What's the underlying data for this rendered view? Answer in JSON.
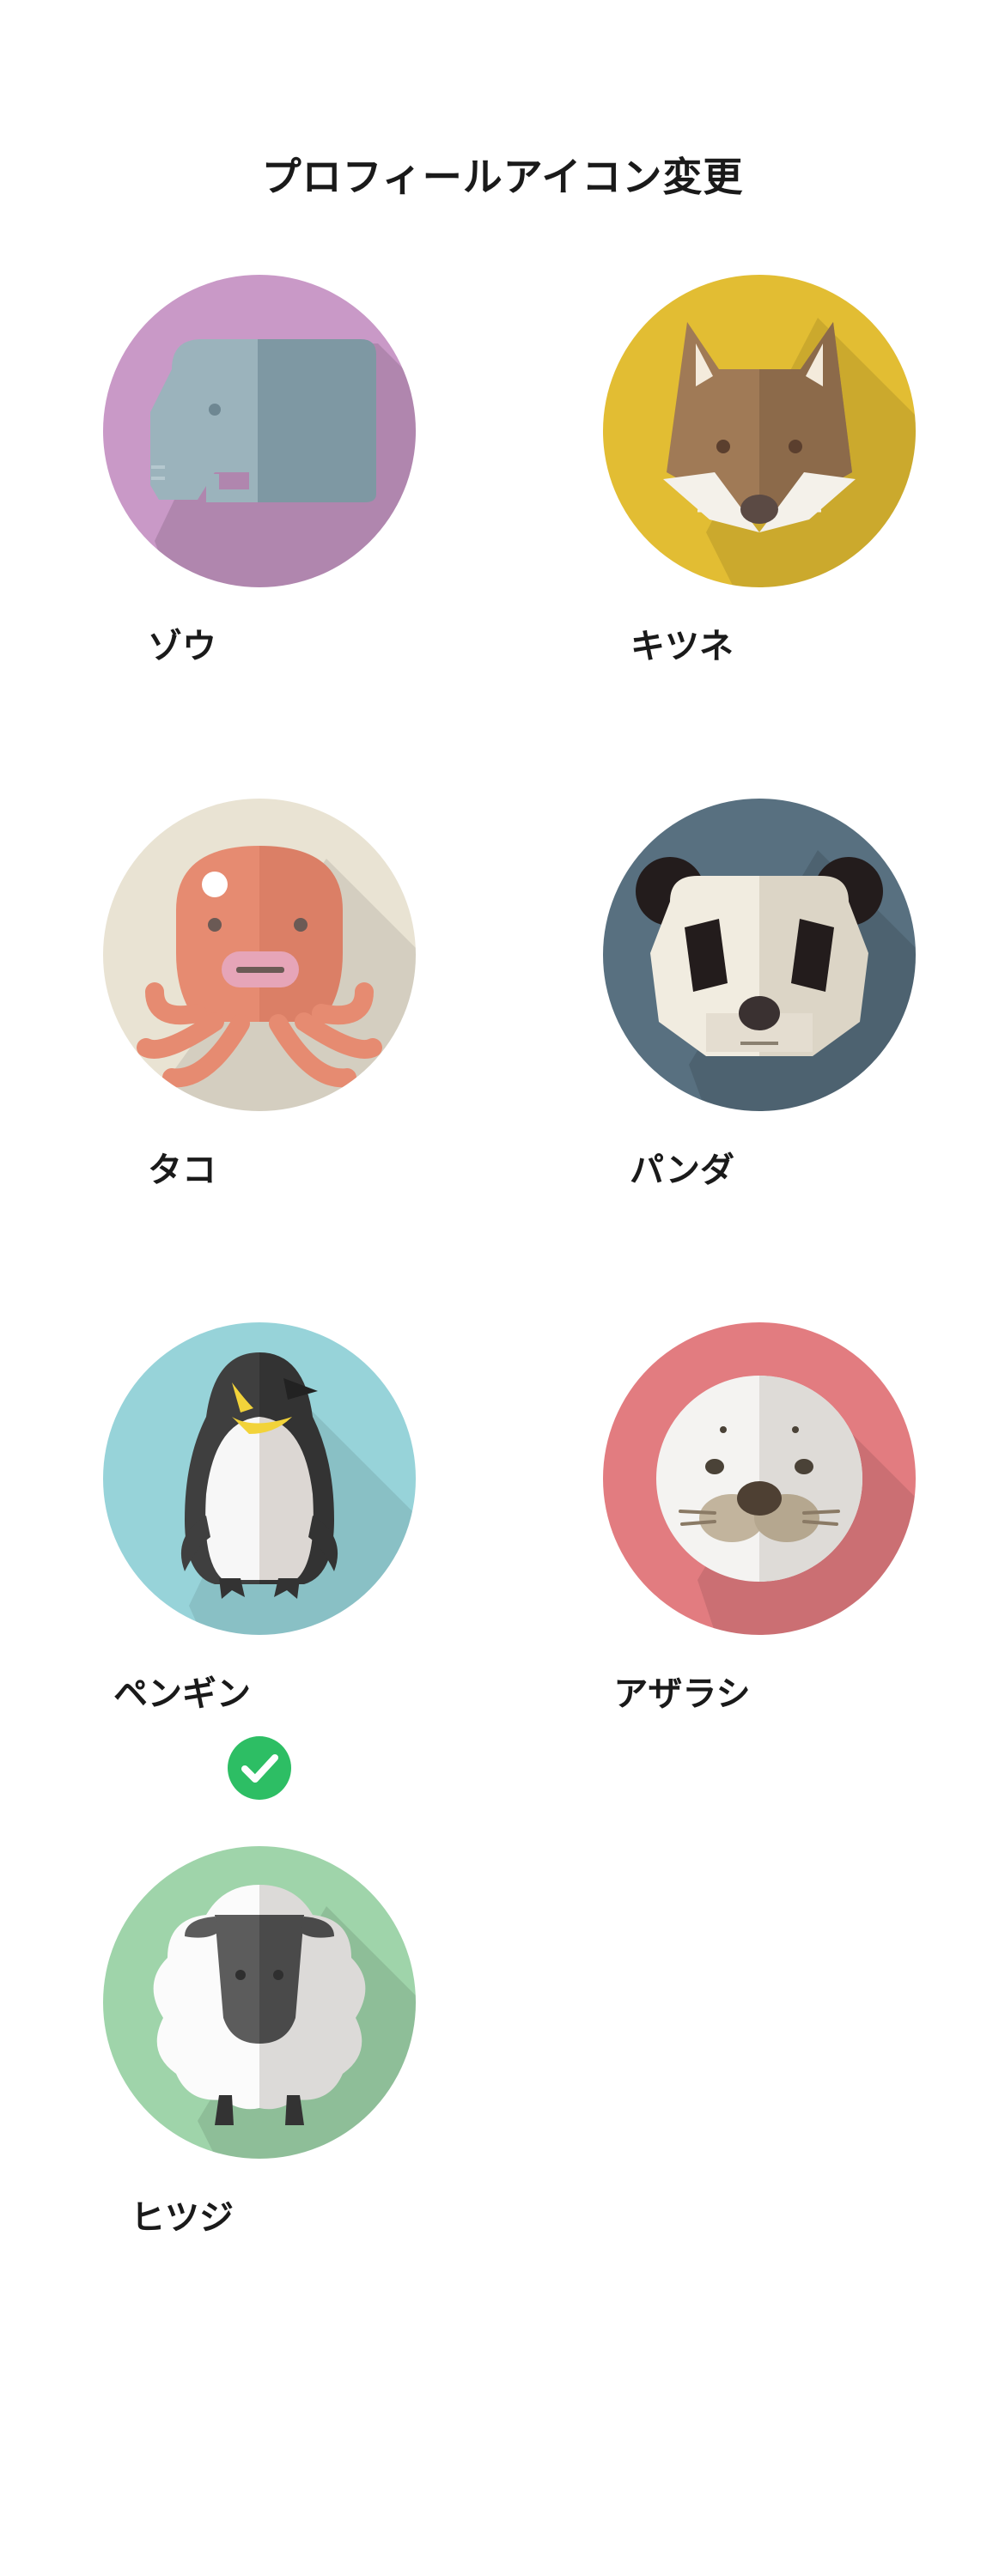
{
  "page": {
    "title": "プロフィールアイコン変更"
  },
  "icons": [
    {
      "label": "ゾウ",
      "bg": "#c999c7",
      "icon": "elephant-icon"
    },
    {
      "label": "キツネ",
      "bg": "#e2bd33",
      "icon": "fox-icon"
    },
    {
      "label": "タコ",
      "bg": "#e9e3d3",
      "icon": "octopus-icon"
    },
    {
      "label": "パンダ",
      "bg": "#587080",
      "icon": "panda-icon"
    },
    {
      "label": "ペンギン",
      "bg": "#97d3d9",
      "icon": "penguin-icon"
    },
    {
      "label": "アザラシ",
      "bg": "#e27c80",
      "icon": "seal-icon"
    },
    {
      "label": "ヒツジ",
      "bg": "#9fd4aa",
      "icon": "sheep-icon"
    }
  ],
  "selection": {
    "selected_label": "ペンギン",
    "check_color": "#2dbe64",
    "icon": "check-icon"
  }
}
